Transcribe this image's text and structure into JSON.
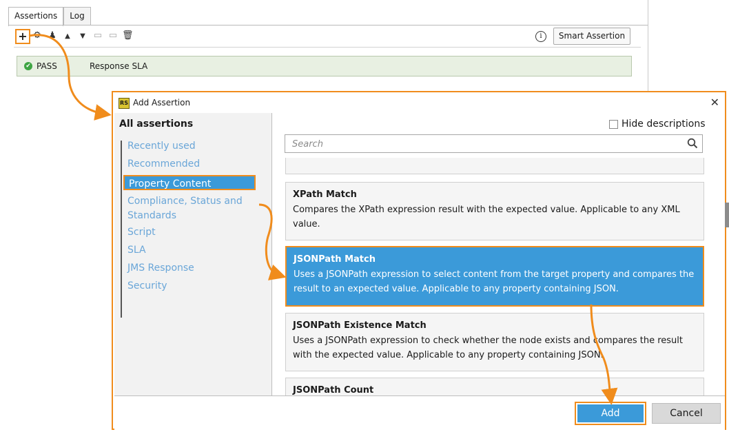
{
  "background": {
    "tabs": [
      "Assertions",
      "Log"
    ],
    "toolbar": {
      "icons": [
        "add-icon",
        "configure-icon",
        "clone-icon",
        "move-up-icon",
        "move-down-icon",
        "group-icon",
        "ungroup-icon",
        "delete-icon"
      ],
      "info_label": "i",
      "smart_assertion_label": "Smart Assertion"
    },
    "result": {
      "status": "PASS",
      "name": "Response SLA",
      "status_color": "#3ea543"
    }
  },
  "dialog": {
    "title": "Add Assertion",
    "hide_descriptions_label": "Hide descriptions",
    "search_placeholder": "Search",
    "categories_header": "All assertions",
    "categories": [
      "Recently used",
      "Recommended",
      "Property Content",
      "Compliance, Status and Standards",
      "Script",
      "SLA",
      "JMS Response",
      "Security"
    ],
    "selected_category": "Property Content",
    "assertions": [
      {
        "title": "XPath Match",
        "desc": "Compares the XPath expression result with the expected value. Applicable to any XML value."
      },
      {
        "title": "JSONPath Match",
        "desc": "Uses a JSONPath expression to select content from the target property and compares the result to an expected value. Applicable to any property containing JSON."
      },
      {
        "title": "JSONPath Existence Match",
        "desc": "Uses a JSONPath expression to check whether the node exists and compares the result with the expected value. Applicable to any property containing JSON."
      },
      {
        "title": "JSONPath Count",
        "desc": ""
      }
    ],
    "buttons": {
      "add": "Add",
      "cancel": "Cancel"
    }
  },
  "colors": {
    "accent": "#3b9ad9",
    "highlight": "#f08c1c",
    "link": "#6aa6d8"
  }
}
